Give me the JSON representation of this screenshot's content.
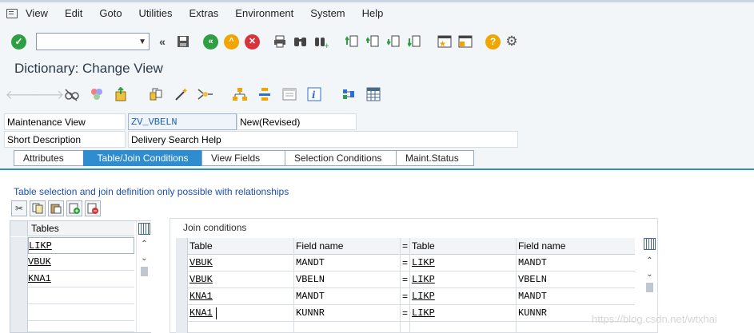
{
  "menu": {
    "items": [
      {
        "label": "View"
      },
      {
        "label": "Edit"
      },
      {
        "label": "Goto"
      },
      {
        "label": "Utilities"
      },
      {
        "label": "Extras"
      },
      {
        "label": "Environment"
      },
      {
        "label": "System"
      },
      {
        "label": "Help"
      }
    ]
  },
  "toolbar": {
    "command_field_value": ""
  },
  "page": {
    "title": "Dictionary: Change View"
  },
  "header": {
    "maintenance_view_label": "Maintenance View",
    "maintenance_view_value": "ZV_VBELN",
    "status_value": "New(Revised)",
    "short_description_label": "Short Description",
    "short_description_value": "Delivery Search Help"
  },
  "tabs": [
    {
      "label": "Attributes",
      "active": false
    },
    {
      "label": "Table/Join Conditions",
      "active": true
    },
    {
      "label": "View Fields",
      "active": false
    },
    {
      "label": "Selection Conditions",
      "active": false
    },
    {
      "label": "Maint.Status",
      "active": false
    }
  ],
  "hint_text": "Table selection and join definition only possible with relationships",
  "tables": {
    "header": "Tables",
    "rows": [
      "LIKP",
      "VBUK",
      "KNA1",
      "",
      "",
      ""
    ]
  },
  "join_conditions": {
    "title": "Join conditions",
    "columns": {
      "table1": "Table",
      "field1": "Field name",
      "eq": "=",
      "table2": "Table",
      "field2": "Field name"
    },
    "rows": [
      {
        "table1": "VBUK",
        "field1": "MANDT",
        "eq": "=",
        "table2": "LIKP",
        "field2": "MANDT"
      },
      {
        "table1": "VBUK",
        "field1": "VBELN",
        "eq": "=",
        "table2": "LIKP",
        "field2": "VBELN"
      },
      {
        "table1": "KNA1",
        "field1": "MANDT",
        "eq": "=",
        "table2": "LIKP",
        "field2": "MANDT"
      },
      {
        "table1": "KNA1",
        "field1": "KUNNR",
        "eq": "=",
        "table2": "LIKP",
        "field2": "KUNNR"
      },
      {
        "table1": "",
        "field1": "",
        "eq": "",
        "table2": "",
        "field2": ""
      }
    ]
  },
  "watermark": "https://blog.csdn.net/wtxhai",
  "colors": {
    "accent": "#2f8ccf",
    "background": "#f3f6f9",
    "hint": "#1d4fb0"
  }
}
